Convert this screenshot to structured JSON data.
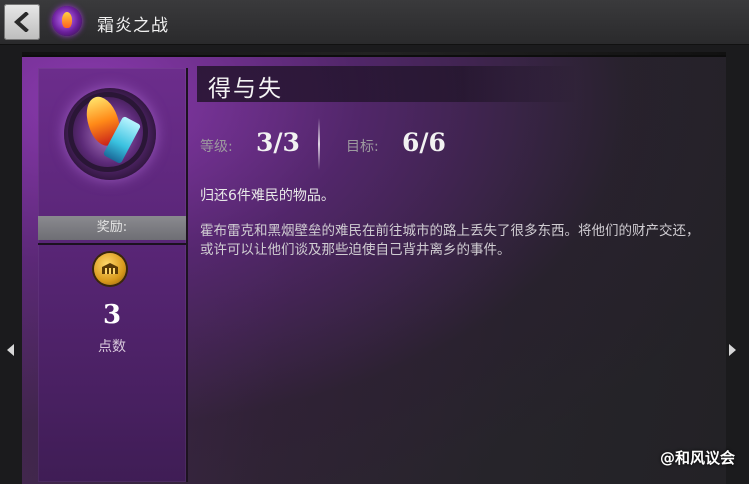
{
  "header": {
    "title": "霜炎之战"
  },
  "icons": {
    "back": "back-arrow-icon",
    "title": "frost-flame-icon",
    "reward": "mastery-point-icon"
  },
  "quest": {
    "title": "得与失",
    "level_label": "等级:",
    "level_value": "3/3",
    "goal_label": "目标:",
    "goal_value": "6/6",
    "summary": "归还6件难民的物品。",
    "description": "霍布雷克和黑烟壁垒的难民在前往城市的路上丢失了很多东西。将他们的财产交还，或许可以让他们谈及那些迫使自己背井离乡的事件。"
  },
  "reward": {
    "label": "奖励:",
    "count": "3",
    "unit": "点数"
  },
  "watermark": "@和风议会",
  "colors": {
    "accent": "#6c2d8c",
    "panel": "#26242a",
    "reward_bar": "#7d7d82"
  }
}
